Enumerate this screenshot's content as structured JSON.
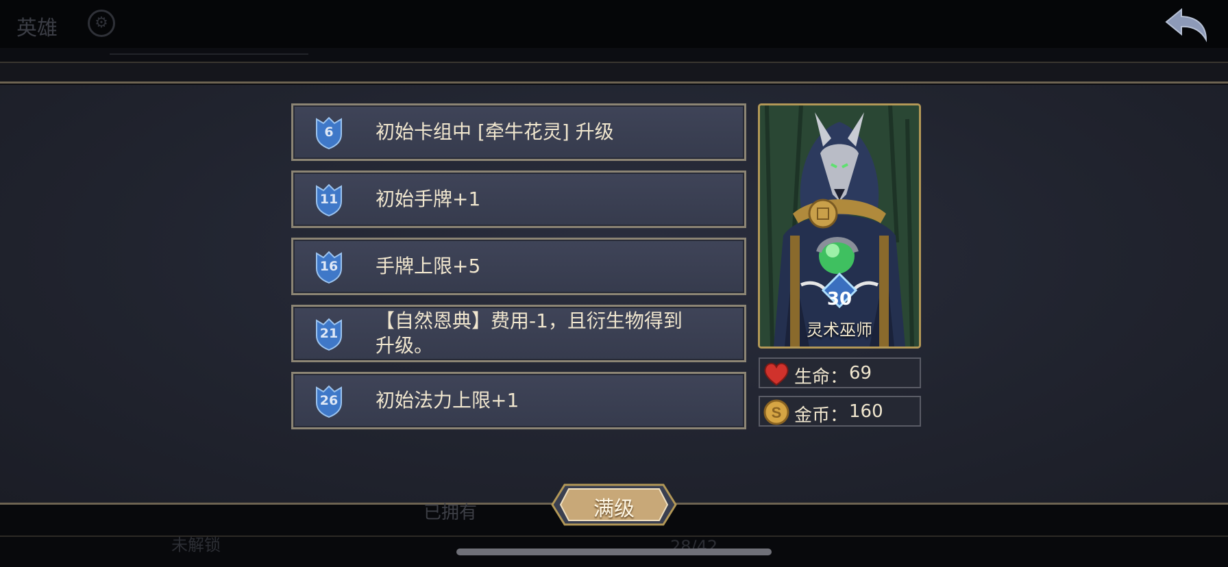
{
  "top": {
    "title": "英雄",
    "icon": "gear-icon"
  },
  "talents": [
    {
      "level": "6",
      "text": "初始卡组中 [牵牛花灵] 升级"
    },
    {
      "level": "11",
      "text": "初始手牌+1"
    },
    {
      "level": "16",
      "text": "手牌上限+5"
    },
    {
      "level": "21",
      "text": "【自然恩典】费用-1，且衍生物得到升级。"
    },
    {
      "level": "26",
      "text": "初始法力上限+1"
    }
  ],
  "hero": {
    "level": "30",
    "name": "灵术巫师"
  },
  "stats": [
    {
      "icon": "heart-icon",
      "label": "生命：",
      "value": "69"
    },
    {
      "icon": "coin-icon",
      "label": "金币：",
      "value": "160"
    }
  ],
  "button": {
    "max_label": "满级"
  },
  "background": {
    "owned": "已拥有",
    "count": "28/42",
    "tab": "未解锁"
  },
  "colors": {
    "accent_gold": "#b39857",
    "panel": "#3f4458",
    "badge_blue": "#3f78c8",
    "button_tan": "#c8a878"
  }
}
